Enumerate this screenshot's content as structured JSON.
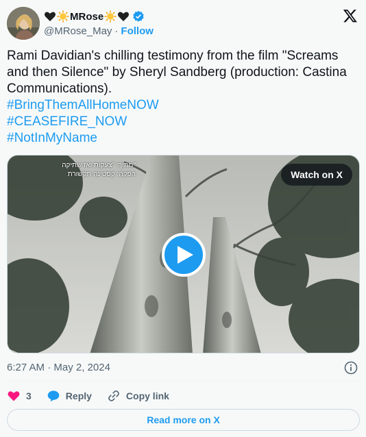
{
  "author": {
    "display_name": "MRose",
    "handle": "@MRose_May",
    "separator": "·",
    "follow_label": "Follow",
    "verified": true
  },
  "tweet": {
    "text": "Rami Davidian's chilling testimony from the film \"Screams and then Silence\" by Sheryl Sandberg (production: Castina Communications).",
    "hashtags": [
      "#BringThemAllHomeNOW",
      "#CEASEFIRE_NOW",
      "#NotInMyName"
    ]
  },
  "media": {
    "overlay_line1": "מתוך: \"צעקות ואז שתיקה\"",
    "overlay_line2": "הפקה: קסטינה תקשורת",
    "watch_label": "Watch on X"
  },
  "meta": {
    "timestamp": "6:27 AM · May 2, 2024"
  },
  "actions": {
    "like_count": "3",
    "reply_label": "Reply",
    "copy_link_label": "Copy link"
  },
  "footer": {
    "read_more_label": "Read more on X"
  },
  "colors": {
    "accent": "#1d9bf0",
    "like": "#f91880",
    "text_secondary": "#536471",
    "background": "#f7f9f9"
  },
  "icons": [
    "black-heart-icon",
    "sun-icon",
    "verified-badge-icon",
    "x-logo-icon",
    "play-icon",
    "info-icon",
    "heart-icon",
    "reply-icon",
    "link-icon"
  ]
}
